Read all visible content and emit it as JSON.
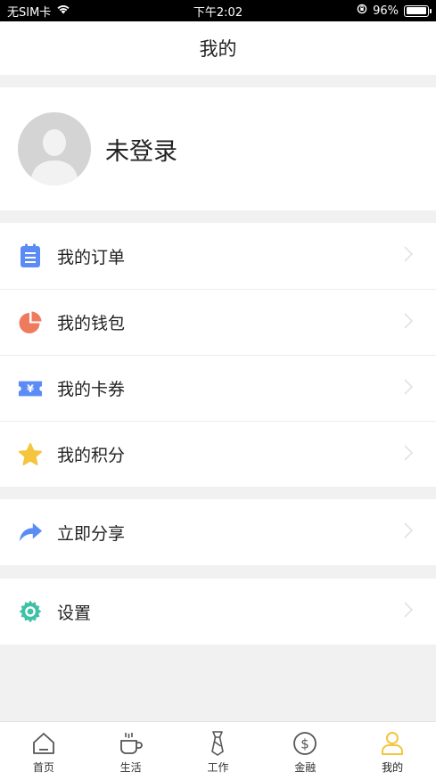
{
  "status_bar": {
    "carrier": "无SIM卡",
    "time": "下午2:02",
    "battery_text": "96%",
    "battery_level": 0.96
  },
  "nav": {
    "title": "我的"
  },
  "profile": {
    "login_status": "未登录"
  },
  "menu_main": [
    {
      "label": "我的订单",
      "icon": "clipboard-icon",
      "color": "#5b8cf5"
    },
    {
      "label": "我的钱包",
      "icon": "pie-chart-icon",
      "color": "#ef7b5e"
    },
    {
      "label": "我的卡券",
      "icon": "ticket-icon",
      "color": "#5b8cf5"
    },
    {
      "label": "我的积分",
      "icon": "star-icon",
      "color": "#f4c53d"
    }
  ],
  "menu_share": {
    "label": "立即分享",
    "icon": "share-arrow-icon",
    "color": "#5b8cf5"
  },
  "menu_settings": {
    "label": "设置",
    "icon": "gear-icon",
    "color": "#3fc1a5"
  },
  "tabs": [
    {
      "label": "首页",
      "icon": "home-icon"
    },
    {
      "label": "生活",
      "icon": "coffee-icon"
    },
    {
      "label": "工作",
      "icon": "tie-icon"
    },
    {
      "label": "金融",
      "icon": "dollar-icon"
    },
    {
      "label": "我的",
      "icon": "person-icon",
      "active": true,
      "accent": "#f4c53d"
    }
  ]
}
